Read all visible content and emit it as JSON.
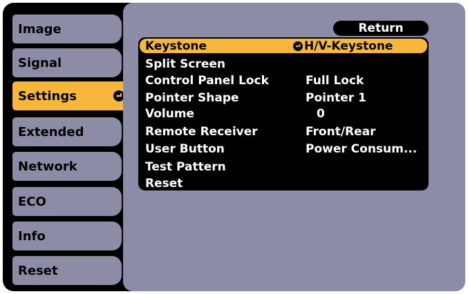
{
  "tabs": [
    {
      "label": "Image"
    },
    {
      "label": "Signal"
    },
    {
      "label": "Settings"
    },
    {
      "label": "Extended"
    },
    {
      "label": "Network"
    },
    {
      "label": "ECO"
    },
    {
      "label": "Info"
    },
    {
      "label": "Reset"
    }
  ],
  "return_label": "Return",
  "items": [
    {
      "label": "Keystone",
      "value": "H/V-Keystone"
    },
    {
      "label": "Split Screen",
      "value": ""
    },
    {
      "label": "Control Panel Lock",
      "value": "Full Lock"
    },
    {
      "label": "Pointer Shape",
      "value": "Pointer 1"
    },
    {
      "label": "Volume",
      "value": "0"
    },
    {
      "label": "Remote Receiver",
      "value": "Front/Rear"
    },
    {
      "label": "User Button",
      "value": "Power Consum..."
    },
    {
      "label": "Test Pattern",
      "value": ""
    },
    {
      "label": "Reset",
      "value": ""
    }
  ],
  "colors": {
    "accent": "#f6b73c",
    "tab": "#8c8ca6",
    "frame": "#000000"
  }
}
